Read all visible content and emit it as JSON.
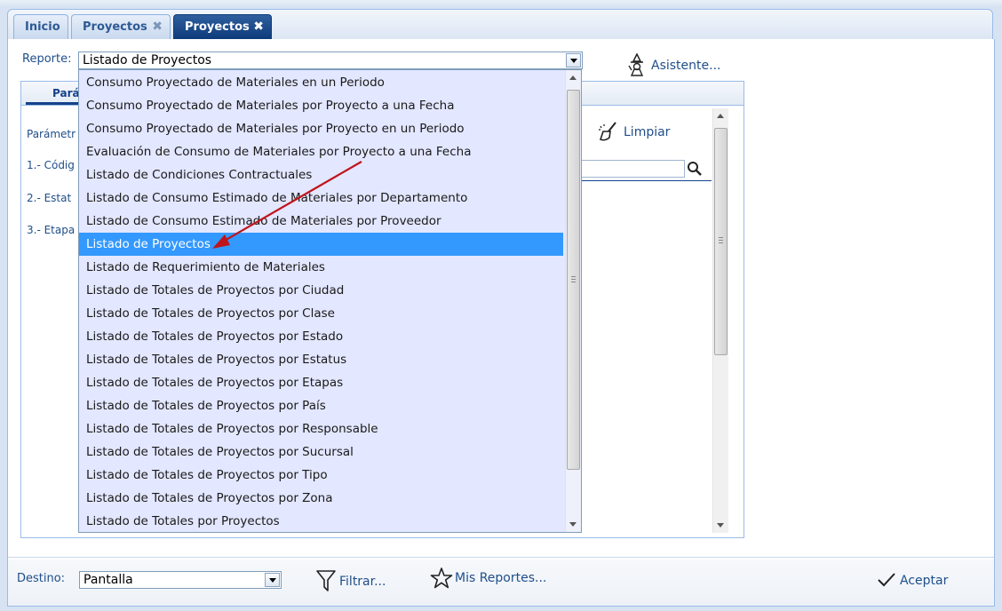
{
  "tabs": [
    {
      "label": "Inicio",
      "active": false,
      "closable": false
    },
    {
      "label": "Proyectos",
      "active": false,
      "closable": true
    },
    {
      "label": "Proyectos",
      "active": true,
      "closable": true
    }
  ],
  "tab_close_glyph": "✖",
  "reporte": {
    "label": "Reporte:",
    "selected": "Listado de Proyectos",
    "options": [
      "Consumo Proyectado de Materiales en un Periodo",
      "Consumo Proyectado de Materiales por Proyecto a una Fecha",
      "Consumo Proyectado de Materiales por Proyecto en un Periodo",
      "Evaluación de Consumo de Materiales por Proyecto a una Fecha",
      "Listado de Condiciones Contractuales",
      "Listado de Consumo Estimado de Materiales por Departamento",
      "Listado de Consumo Estimado de Materiales por Proveedor",
      "Listado de Proyectos",
      "Listado de Requerimiento de Materiales",
      "Listado de Totales de Proyectos por Ciudad",
      "Listado de Totales de Proyectos por Clase",
      "Listado de Totales de Proyectos por Estado",
      "Listado de Totales de Proyectos por Estatus",
      "Listado de Totales de Proyectos por Etapas",
      "Listado de Totales de Proyectos por País",
      "Listado de Totales de Proyectos por Responsable",
      "Listado de Totales de Proyectos por Sucursal",
      "Listado de Totales de Proyectos por Tipo",
      "Listado de Totales de Proyectos por Zona",
      "Listado de Totales por Proyectos"
    ],
    "highlighted_index": 7
  },
  "asistente_label": "Asistente...",
  "params": {
    "tab_label": "Pará",
    "header": "Parámetr",
    "lines": [
      "1.- Códig",
      "2.- Estat",
      "3.- Etapa"
    ],
    "limpiar_label": "Limpiar"
  },
  "destino": {
    "label": "Destino:",
    "value": "Pantalla"
  },
  "toolbar": {
    "filtrar_label": "Filtrar...",
    "mis_reportes_label": "Mis Reportes...",
    "aceptar_label": "Aceptar"
  },
  "icons": {
    "wizard": "wizard-icon",
    "limpiar": "broom-icon",
    "search": "search-icon",
    "filter": "filter-icon",
    "star": "star-icon",
    "check": "check-icon"
  },
  "colors": {
    "selected_item": "#3399ff",
    "active_tab": "#0e3a7a",
    "annotation_arrow": "#c0141c"
  }
}
